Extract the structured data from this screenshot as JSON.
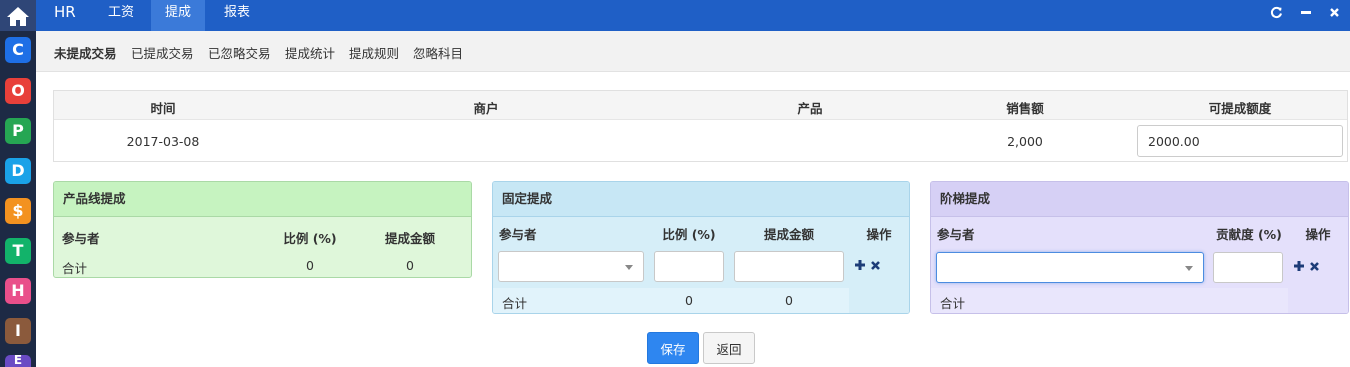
{
  "app": {
    "brand": "HR",
    "nav_tabs": [
      {
        "label": "工资"
      },
      {
        "label": "提成"
      },
      {
        "label": "报表"
      }
    ]
  },
  "rail": {
    "items": [
      {
        "glyph": "C",
        "color": "#1e6fe6"
      },
      {
        "glyph": "O",
        "color": "#e8403a"
      },
      {
        "glyph": "P",
        "color": "#26a653"
      },
      {
        "glyph": "D",
        "color": "#1aa2e8"
      },
      {
        "glyph": "$",
        "color": "#f39220"
      },
      {
        "glyph": "T",
        "color": "#12b36a"
      },
      {
        "glyph": "H",
        "color": "#e94f8a"
      },
      {
        "glyph": "I",
        "color": "#8b5a3c"
      },
      {
        "glyph": "E",
        "color": "#6a4bc4"
      }
    ]
  },
  "subnav": {
    "items": [
      {
        "label": "未提成交易"
      },
      {
        "label": "已提成交易"
      },
      {
        "label": "已忽略交易"
      },
      {
        "label": "提成统计"
      },
      {
        "label": "提成规则"
      },
      {
        "label": "忽略科目"
      }
    ]
  },
  "transaction": {
    "headers": [
      "时间",
      "商户",
      "产品",
      "销售额",
      "可提成额度"
    ],
    "row": {
      "date": "2017-03-08",
      "merchant": "",
      "product": "",
      "sales": "2,000",
      "commissionable": "2000.00"
    }
  },
  "product_line_panel": {
    "title": "产品线提成",
    "headers": [
      "参与者",
      "比例 (%)",
      "提成金额"
    ],
    "total": {
      "label": "合计",
      "ratio": "0",
      "amount": "0"
    }
  },
  "fixed_panel": {
    "title": "固定提成",
    "headers": [
      "参与者",
      "比例 (%)",
      "提成金额",
      "操作"
    ],
    "total": {
      "label": "合计",
      "ratio": "0",
      "amount": "0"
    }
  },
  "tiered_panel": {
    "title": "阶梯提成",
    "headers": [
      "参与者",
      "贡献度 (%)",
      "操作"
    ],
    "total": {
      "label": "合计"
    }
  },
  "actions": {
    "save": "保存",
    "back": "返回"
  }
}
